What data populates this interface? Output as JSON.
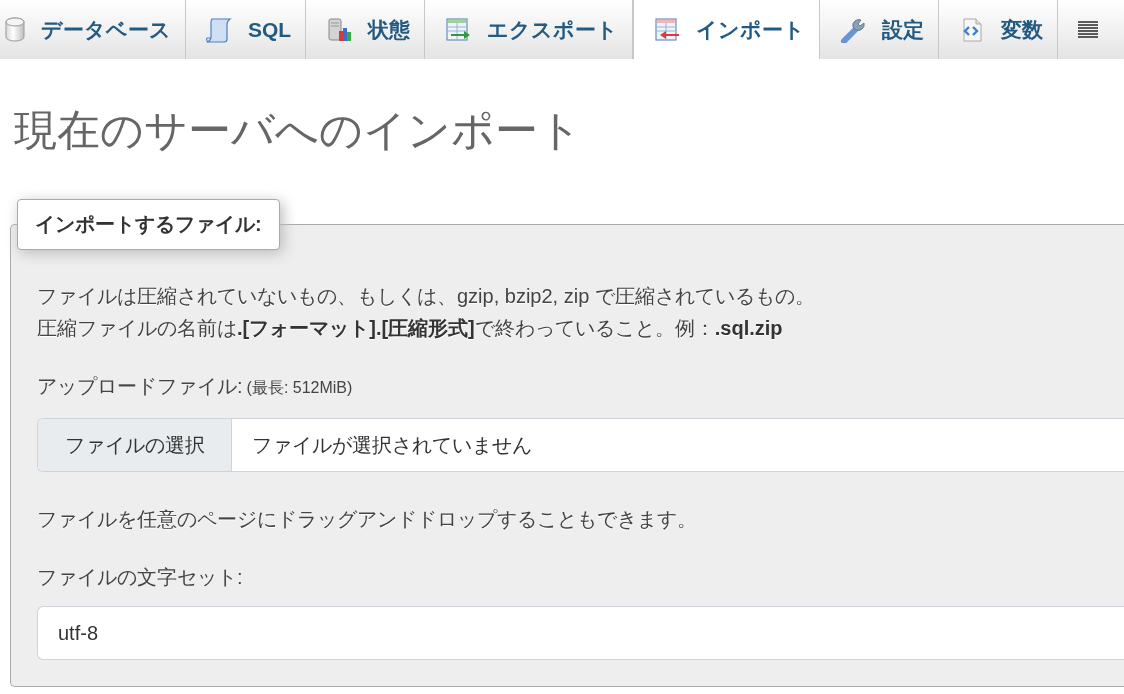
{
  "tabs": [
    {
      "label": "データベース",
      "selected": false
    },
    {
      "label": "SQL",
      "selected": false
    },
    {
      "label": "状態",
      "selected": false
    },
    {
      "label": "エクスポート",
      "selected": false
    },
    {
      "label": "インポート",
      "selected": true
    },
    {
      "label": "設定",
      "selected": false
    },
    {
      "label": "変数",
      "selected": false
    },
    {
      "selected": false
    }
  ],
  "page_title": "現在のサーバへのインポート",
  "file_section": {
    "legend": "インポートするファイル:",
    "description": [
      "ファイルは圧縮されていないもの、もしくは、gzip, bzip2, zip で圧縮されているもの。",
      "圧縮ファイルの名前は**.[フォーマット].[圧縮形式]**で終わっていること。例：**.sql.zip**"
    ],
    "upload_label": "アップロードファイル:",
    "upload_limit": "(最長: 512MiB)",
    "file_input": {
      "button": "ファイルの選択",
      "status": "ファイルが選択されていません"
    },
    "drag_hint": "ファイルを任意のページにドラッグアンドドロップすることもできます。",
    "charset_label": "ファイルの文字セット:",
    "charset_select": {
      "value": "utf-8"
    }
  }
}
